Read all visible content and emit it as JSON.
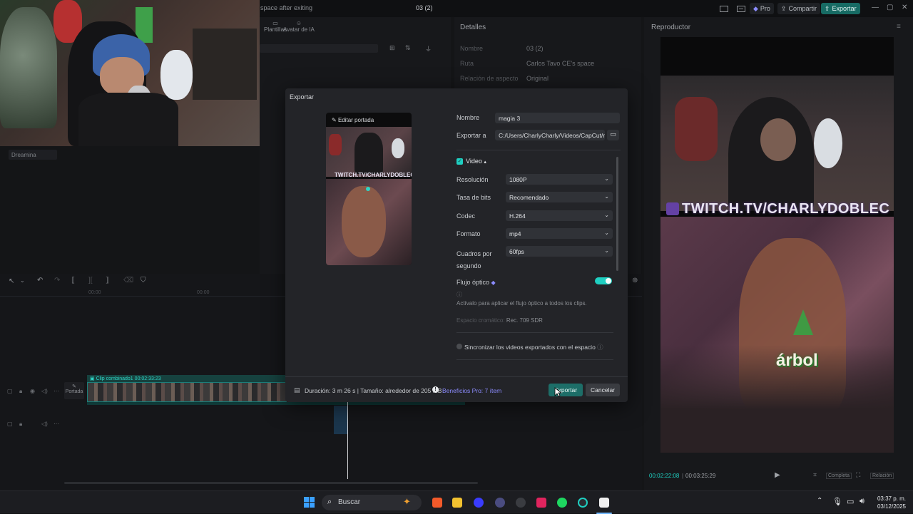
{
  "titlebar": {
    "status": "space after exiting",
    "project_name": "03 (2)",
    "pro_label": "Pro",
    "share_label": "Compartir",
    "export_label": "Exportar"
  },
  "toolbar": {
    "templates_label": "Plantillas",
    "avatar_label": "Avatar de IA"
  },
  "left_panel": {
    "dreamina_label": "Dreamina"
  },
  "details": {
    "header": "Detalles",
    "rows": [
      {
        "label": "Nombre",
        "value": "03 (2)"
      },
      {
        "label": "Ruta",
        "value": "Carlos Tavo CE's space"
      },
      {
        "label": "Relación de aspecto",
        "value": "Original"
      }
    ]
  },
  "player": {
    "header": "Reproductor",
    "current_time": "00:02:22:08",
    "total_time": "00:03:25:29",
    "complete_label": "Completa",
    "ratio_label": "Relación",
    "overlay_url": "TWITCH.TV/CHARLYDOBLEC",
    "overlay_caption": "árbol"
  },
  "timeline": {
    "time_ticks": [
      "00:00",
      "00:00"
    ],
    "clip_label": "Clip combinado1",
    "clip_duration": "00:02:33:23",
    "cover_label": "Portada"
  },
  "dialog": {
    "title": "Exportar",
    "edit_cover": "Editar portada",
    "thumb_url": "TWITCH.TV/CHARLYDOBLEC",
    "name_label": "Nombre",
    "name_value": "magia 3",
    "export_to_label": "Exportar a",
    "export_path": "C:/Users/CharlyCharly/Videos/CapCut/m...",
    "video_section": "Video",
    "resolution_label": "Resolución",
    "resolution_value": "1080P",
    "bitrate_label": "Tasa de bits",
    "bitrate_value": "Recomendado",
    "codec_label": "Codec",
    "codec_value": "H.264",
    "format_label": "Formato",
    "format_value": "mp4",
    "fps_label": "Cuadros por segundo",
    "fps_value": "60fps",
    "optical_flow_label": "Flujo óptico",
    "optical_flow_hint": "Actívalo para aplicar el flujo óptico a todos los clips.",
    "color_space_label": "Espacio cromático:",
    "color_space_value": "Rec. 709 SDR",
    "sync_label": "Sincronizar los videos exportados con el espacio",
    "footer_info": "Duración: 3 m 26 s | Tamaño: alrededor de 205 MB",
    "pro_benefits": "Beneficios Pro: 7 ítem",
    "export_button": "Exportar",
    "cancel_button": "Cancelar"
  },
  "taskbar": {
    "search_placeholder": "Buscar",
    "time": "03:37 p. m.",
    "date": "03/12/2025"
  },
  "colors": {
    "accent": "#1fcfc1",
    "pro_link": "#8c8cff",
    "export_btn": "#1d6e68"
  }
}
